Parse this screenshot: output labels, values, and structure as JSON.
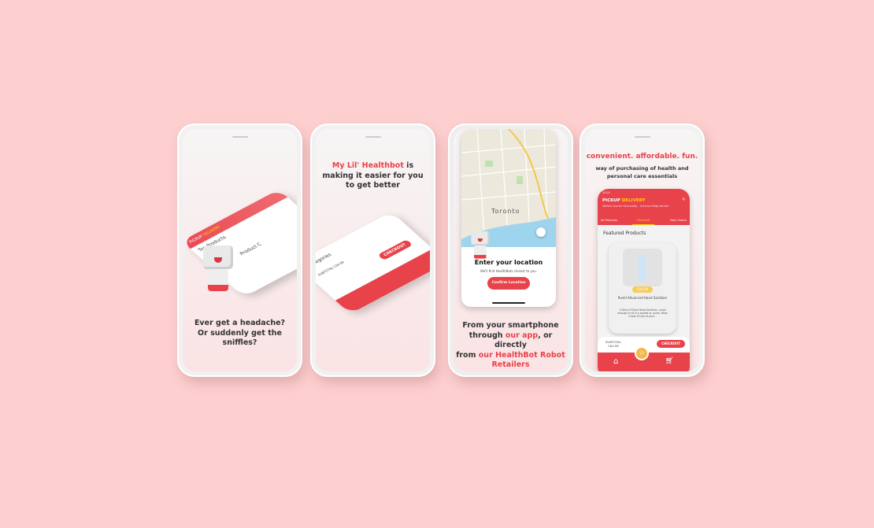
{
  "phone1": {
    "caption": [
      "Ever get a headache?",
      "Or suddenly get the",
      "sniffles?"
    ],
    "mock": {
      "pickup": "PICKUP",
      "delivery": "DELIVERY",
      "top_products": "Top Products",
      "product_categories": "Product C"
    }
  },
  "phone2": {
    "caption_highlight": "My Lil' Healthbot",
    "caption_rest1": " is",
    "caption_line2": "making it easier for you",
    "caption_line3": "to get better",
    "mock": {
      "categories": "Categories",
      "checkout": "CHECKOUT",
      "subtotal": "SUBTOTAL C$4.99"
    }
  },
  "phone3": {
    "map_label": "Toronto",
    "title": "Enter your location",
    "subtitle": "We'll find HealthBots closest to you.",
    "button": "Confirm Location",
    "caption": {
      "l1": "From your smartphone",
      "l2a": "through ",
      "l2b": "our app",
      "l2c": ", or directly",
      "l3a": "from ",
      "l3b": "our HealthBot Robot",
      "l4": "Retailers"
    }
  },
  "phone4": {
    "tagline": "convenient. affordable. fun.",
    "sub1": "way of purchasing of health and",
    "sub2": "personal care essentials",
    "app": {
      "time": "10:21",
      "pickup": "PICKUP",
      "delivery": "DELIVERY",
      "location": "Wilfrid Laurier University - Science Bldg Atrium",
      "tabs": [
        "All Products",
        "Featured",
        "Past Orders"
      ],
      "section": "Featured Products",
      "price": "C$4.99",
      "product": "Purell Advanced Hand Sanitizer",
      "description": "118ml of Purell Hand Sanitizer, small enough to fit in a pocket or purse. Keep Covid-19 out of your...",
      "subtotal_label": "SUBTOTAL",
      "subtotal": "C$4.99",
      "checkout": "CHECKOUT"
    }
  },
  "colors": {
    "accent": "#e8424a",
    "yellow": "#ffd400",
    "background": "#fdcfcf"
  }
}
